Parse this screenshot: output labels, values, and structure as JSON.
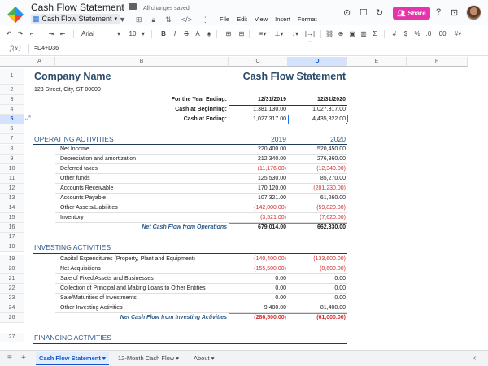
{
  "app": {
    "doc_title": "Cash Flow Statement",
    "active_sheet_tab": "Cash Flow Statement",
    "save_status": "All changes saved",
    "menus": [
      "File",
      "Edit",
      "View",
      "Insert",
      "Format"
    ],
    "share_label": "Share",
    "icons": {
      "logo": "smartsheet-logo-icon",
      "filter": "filter-icon",
      "menu": "more-icon",
      "folder": "folder-icon",
      "lock": "lock-icon",
      "star": "star-icon"
    }
  },
  "toolbar": {
    "font": "Arial",
    "font_size": "10"
  },
  "formula_bar": {
    "fx_label": "f(x)",
    "formula": "=D4+D36"
  },
  "columns": [
    "A",
    "B",
    "C",
    "D",
    "E",
    "F"
  ],
  "sheet": {
    "company_name": "Company Name",
    "address": "123 Street, City, ST  00000",
    "statement_title": "Cash Flow Statement",
    "year_ending_label": "For the Year Ending:",
    "year_ending_c": "12/31/2019",
    "year_ending_d": "12/31/2020",
    "cash_begin_label": "Cash at Beginning:",
    "cash_begin_c": "1,381,130.00",
    "cash_begin_d": "1,027,317.00",
    "cash_end_label": "Cash at Ending:",
    "cash_end_c": "1,027,317.00",
    "cash_end_d": "4,435,822.00",
    "operating": {
      "title": "OPERATING ACTIVITIES",
      "year_c": "2019",
      "year_d": "2020",
      "items": [
        {
          "label": "Net Income",
          "c": "220,400.00",
          "d": "520,450.00",
          "cneg": false,
          "dneg": false
        },
        {
          "label": "Depreciation and amortization",
          "c": "212,340.00",
          "d": "276,360.00",
          "cneg": false,
          "dneg": false
        },
        {
          "label": "Deferred taxes",
          "c": "(11,176.00)",
          "d": "(12,340.00)",
          "cneg": true,
          "dneg": true
        },
        {
          "label": "Other funds",
          "c": "125,530.00",
          "d": "85,270.00",
          "cneg": false,
          "dneg": false
        },
        {
          "label": "Accounts Receivable",
          "c": "170,120.00",
          "d": "(201,230.00)",
          "cneg": false,
          "dneg": true
        },
        {
          "label": "Accounts Payable",
          "c": "107,321.00",
          "d": "61,260.00",
          "cneg": false,
          "dneg": false
        },
        {
          "label": "Other Assets/Liabilities",
          "c": "(142,000.00)",
          "d": "(59,820.00)",
          "cneg": true,
          "dneg": true
        },
        {
          "label": "Inventory",
          "c": "(3,521.00)",
          "d": "(7,620.00)",
          "cneg": true,
          "dneg": true
        }
      ],
      "total_label": "Net Cash Flow from Operations",
      "total_c": "679,014.00",
      "total_d": "662,330.00"
    },
    "investing": {
      "title": "INVESTING ACTIVITIES",
      "items": [
        {
          "label": "Capital Expenditures (Property, Plant and Equipment)",
          "c": "(140,400.00)",
          "d": "(133,600.00)",
          "cneg": true,
          "dneg": true
        },
        {
          "label": "Net Acquisitions",
          "c": "(155,500.00)",
          "d": "(8,600.00)",
          "cneg": true,
          "dneg": true
        },
        {
          "label": "Sale of Fixed Assets and Businesses",
          "c": "0.00",
          "d": "0.00",
          "cneg": false,
          "dneg": false
        },
        {
          "label": "Collection of Principal and Making Loans to Other Entities",
          "c": "0.00",
          "d": "0.00",
          "cneg": false,
          "dneg": false
        },
        {
          "label": "Sale/Maturities of Investments",
          "c": "0.00",
          "d": "0.00",
          "cneg": false,
          "dneg": false
        },
        {
          "label": "Other Investing Activities",
          "c": "9,400.00",
          "d": "81,400.00",
          "cneg": false,
          "dneg": false
        }
      ],
      "total_label": "Net Cash Flow from Investing Activities",
      "total_c": "(286,500.00)",
      "total_d": "(61,000.00)"
    },
    "financing": {
      "title": "FINANCING ACTIVITIES"
    }
  },
  "tabs": [
    "Cash Flow Statement",
    "12-Month Cash Flow",
    "About"
  ]
}
